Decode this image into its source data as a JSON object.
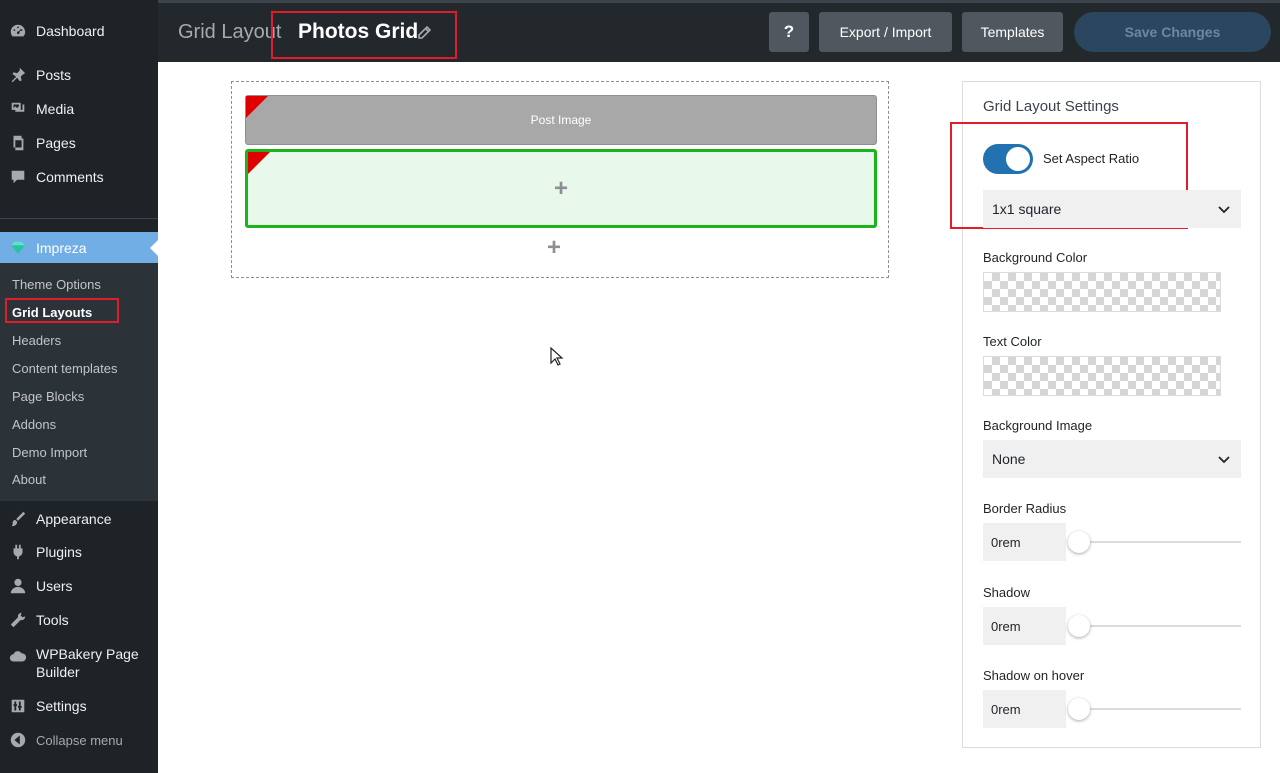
{
  "sidebar": {
    "top_items": [
      {
        "label": "Dashboard",
        "icon": "dashboard-icon"
      },
      {
        "label": "Posts",
        "icon": "pin-icon"
      },
      {
        "label": "Media",
        "icon": "media-icon"
      },
      {
        "label": "Pages",
        "icon": "pages-icon"
      },
      {
        "label": "Comments",
        "icon": "comment-icon"
      }
    ],
    "active": {
      "label": "Impreza",
      "icon": "gem-icon"
    },
    "submenu": [
      "Theme Options",
      "Grid Layouts",
      "Headers",
      "Content templates",
      "Page Blocks",
      "Addons",
      "Demo Import",
      "About"
    ],
    "bottom_items": [
      {
        "label": "Appearance",
        "icon": "brush-icon"
      },
      {
        "label": "Plugins",
        "icon": "plugin-icon"
      },
      {
        "label": "Users",
        "icon": "user-icon"
      },
      {
        "label": "Tools",
        "icon": "wrench-icon"
      },
      {
        "label": "WPBakery Page Builder",
        "icon": "cloud-icon"
      },
      {
        "label": "Settings",
        "icon": "sliders-icon"
      }
    ],
    "collapse_label": "Collapse menu"
  },
  "header": {
    "breadcrumb": "Grid Layout",
    "title": "Photos Grid",
    "help_label": "?",
    "export_label": "Export / Import",
    "templates_label": "Templates",
    "save_label": "Save Changes"
  },
  "canvas": {
    "post_image_label": "Post Image",
    "add_symbol": "+"
  },
  "settings": {
    "title": "Grid Layout Settings",
    "aspect_ratio_label": "Set Aspect Ratio",
    "aspect_ratio_enabled": true,
    "aspect_ratio_value": "1x1 square",
    "background_color_label": "Background Color",
    "text_color_label": "Text Color",
    "background_image_label": "Background Image",
    "background_image_value": "None",
    "border_radius_label": "Border Radius",
    "border_radius_value": "0rem",
    "shadow_label": "Shadow",
    "shadow_value": "0rem",
    "shadow_hover_label": "Shadow on hover",
    "shadow_hover_value": "0rem"
  },
  "colors": {
    "sidebar_bg": "#1d2327",
    "active_bg": "#72aee6",
    "toggle_on": "#2271b1",
    "highlight_red": "#e11d2b",
    "row_green_border": "#1db31d"
  }
}
